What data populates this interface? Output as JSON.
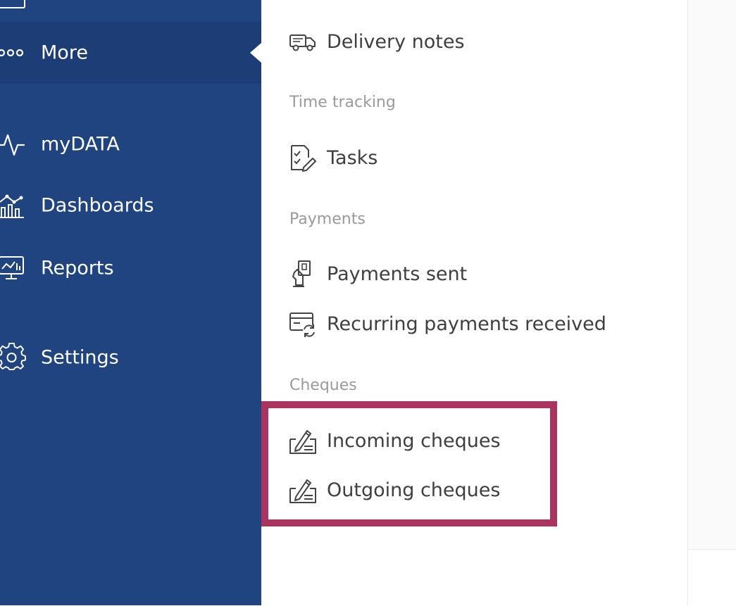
{
  "colors": {
    "sidebar_bg": "#1f4480",
    "sidebar_active_bg": "#1c3d75",
    "sidebar_text": "#ffffff",
    "menu_text": "#3f3f3f",
    "section_header_text": "#9a9a9a",
    "highlight_border": "#a8345f"
  },
  "sidebar": {
    "items": [
      {
        "label": "More",
        "icon": "more-dots-icon",
        "active": true
      },
      {
        "label": "myDATA",
        "icon": "pulse-icon"
      },
      {
        "label": "Dashboards",
        "icon": "chart-icon"
      },
      {
        "label": "Reports",
        "icon": "monitor-chart-icon"
      },
      {
        "label": "Settings",
        "icon": "gear-icon"
      }
    ]
  },
  "menu": {
    "delivery_notes": {
      "label": "Delivery notes",
      "icon": "truck-icon"
    },
    "time_tracking": {
      "header": "Time tracking",
      "tasks": {
        "label": "Tasks",
        "icon": "task-checklist-icon"
      }
    },
    "payments": {
      "header": "Payments",
      "sent": {
        "label": "Payments sent",
        "icon": "payment-hand-icon"
      },
      "recurring": {
        "label": "Recurring payments received",
        "icon": "recurring-card-icon"
      }
    },
    "cheques": {
      "header": "Cheques",
      "incoming": {
        "label": "Incoming cheques",
        "icon": "cheque-pen-icon"
      },
      "outgoing": {
        "label": "Outgoing cheques",
        "icon": "cheque-pen-icon"
      }
    }
  }
}
